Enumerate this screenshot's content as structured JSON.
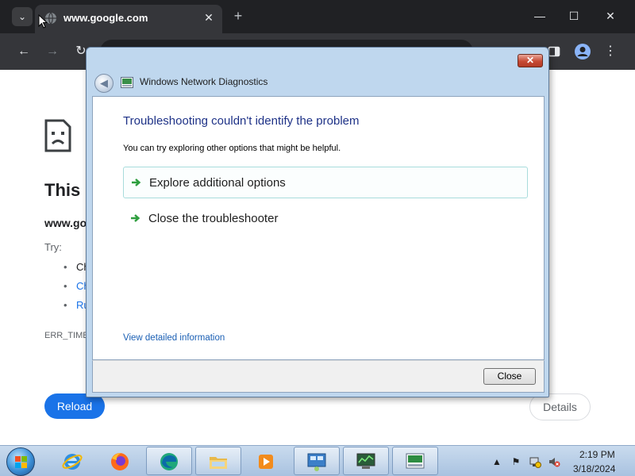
{
  "browser": {
    "tab_title": "www.google.com",
    "tab_close": "✕",
    "new_tab": "+",
    "window_controls": {
      "minimize": "—",
      "maximize": "☐",
      "close": "✕"
    },
    "nav": {
      "back": "←",
      "forward": "→",
      "reload": "↻",
      "menu": "⋮"
    }
  },
  "error_page": {
    "heading": "This site can't be reached",
    "host": "www.google.com",
    "try_label": "Try:",
    "suggestions": [
      "Checking the connection",
      "Checking the proxy and the firewall",
      "Running Windows Network Diagnostics"
    ],
    "code": "ERR_TIMED_OUT",
    "reload_label": "Reload",
    "details_label": "Details",
    "colors": {
      "reload_bg": "#1a73e8",
      "link": "#1a73e8"
    }
  },
  "dialog": {
    "title": "Windows Network Diagnostics",
    "close_glyph": "✕",
    "heading": "Troubleshooting couldn't identify the problem",
    "subtext": "You can try exploring other options that might be helpful.",
    "options": [
      {
        "label": "Explore additional options"
      },
      {
        "label": "Close the troubleshooter"
      }
    ],
    "detail_link": "View detailed information",
    "close_button": "Close",
    "colors": {
      "heading": "#1e3287",
      "frame": "#bfd7ee"
    }
  },
  "taskbar": {
    "apps": [
      "internet-explorer",
      "firefox",
      "edge",
      "file-explorer",
      "media-player",
      "control-panel",
      "network-monitor",
      "network-diagnostics"
    ],
    "clock_time": "2:19 PM",
    "clock_date": "3/18/2024",
    "tray": {
      "show_hidden": "▲",
      "flag": "⚑",
      "volume": "🔈"
    }
  }
}
